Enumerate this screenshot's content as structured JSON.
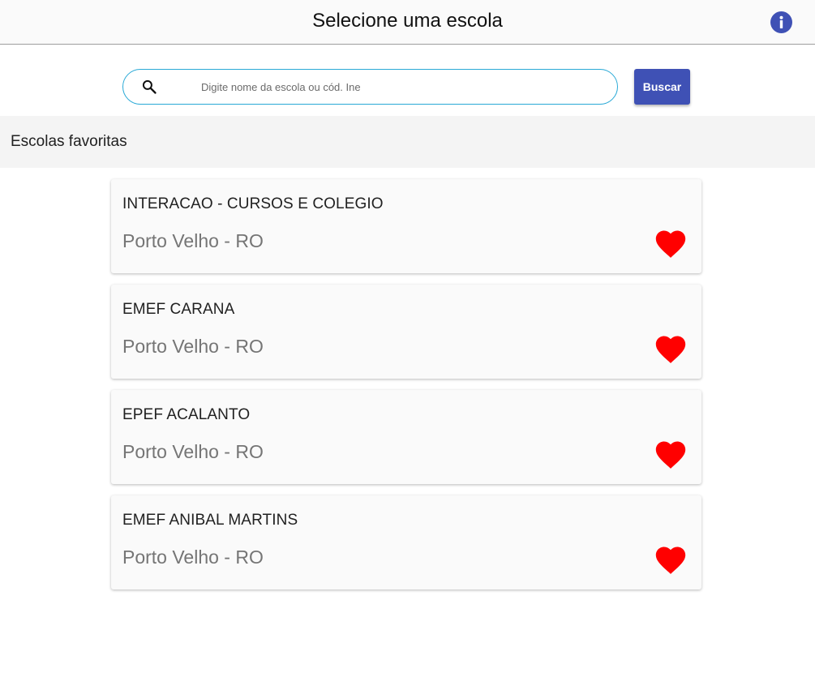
{
  "header": {
    "title": "Selecione uma escola",
    "info_icon": "info-icon"
  },
  "search": {
    "icon": "search-icon",
    "placeholder": "Digite nome da escola ou cód. Ine",
    "value": "",
    "button_label": "Buscar"
  },
  "favorites": {
    "section_title": "Escolas favoritas",
    "items": [
      {
        "name": "INTERACAO - CURSOS E COLEGIO",
        "location": "Porto Velho - RO",
        "favorite_icon": "heart-icon"
      },
      {
        "name": "EMEF CARANA",
        "location": "Porto Velho - RO",
        "favorite_icon": "heart-icon"
      },
      {
        "name": "EPEF ACALANTO",
        "location": "Porto Velho - RO",
        "favorite_icon": "heart-icon"
      },
      {
        "name": "EMEF ANIBAL MARTINS",
        "location": "Porto Velho - RO",
        "favorite_icon": "heart-icon"
      }
    ]
  },
  "colors": {
    "primary": "#3f51b5",
    "search_border": "#29a9d6",
    "favorite": "#ff0000"
  }
}
